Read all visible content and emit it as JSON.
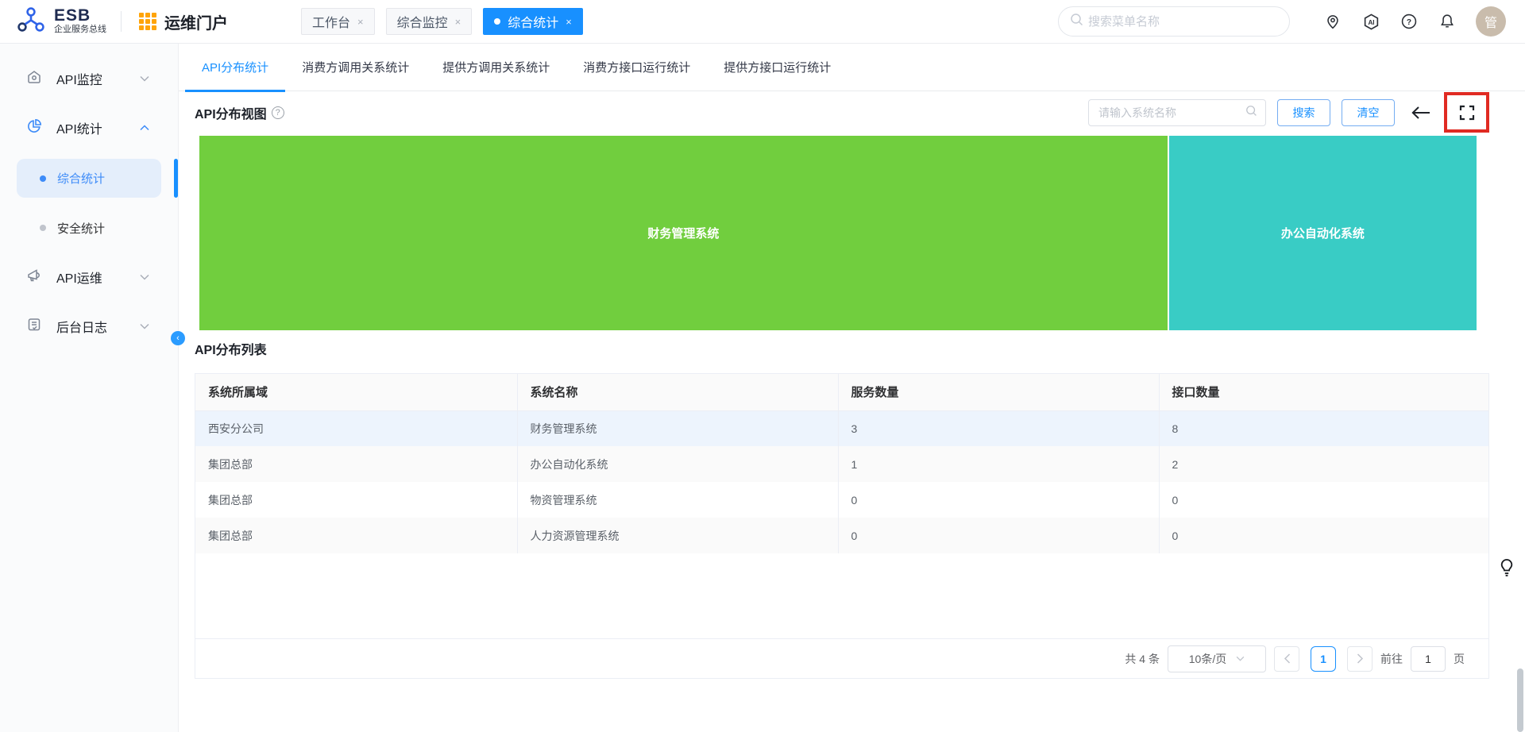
{
  "header": {
    "logo_title": "ESB",
    "logo_subtitle": "企业服务总线",
    "portal_title": "运维门户",
    "window_tabs": [
      {
        "label": "工作台",
        "active": false
      },
      {
        "label": "综合监控",
        "active": false
      },
      {
        "label": "综合统计",
        "active": true
      }
    ],
    "search_placeholder": "搜索菜单名称",
    "avatar_text": "管"
  },
  "sidebar": {
    "items": [
      {
        "label": "API监控"
      },
      {
        "label": "API统计"
      },
      {
        "label": "API运维"
      },
      {
        "label": "后台日志"
      }
    ],
    "children": [
      {
        "label": "综合统计",
        "active": true
      },
      {
        "label": "安全统计",
        "active": false
      }
    ]
  },
  "content": {
    "tabs": [
      {
        "label": "API分布统计",
        "active": true
      },
      {
        "label": "消费方调用关系统计"
      },
      {
        "label": "提供方调用关系统计"
      },
      {
        "label": "消费方接口运行统计"
      },
      {
        "label": "提供方接口运行统计"
      }
    ],
    "view_title": "API分布视图",
    "toolbar": {
      "input_placeholder": "请输入系统名称",
      "search_label": "搜索",
      "clear_label": "清空"
    },
    "list": {
      "title": "API分布列表",
      "columns": [
        "系统所属域",
        "系统名称",
        "服务数量",
        "接口数量"
      ],
      "rows": [
        [
          "西安分公司",
          "财务管理系统",
          "3",
          "8"
        ],
        [
          "集团总部",
          "办公自动化系统",
          "1",
          "2"
        ],
        [
          "集团总部",
          "物资管理系统",
          "0",
          "0"
        ],
        [
          "集团总部",
          "人力资源管理系统",
          "0",
          "0"
        ]
      ]
    },
    "pagination": {
      "total": "共 4 条",
      "page_size": "10条/页",
      "current": "1",
      "goto_label": "前往",
      "goto_value": "1",
      "page_label": "页"
    }
  },
  "chart_data": {
    "type": "treemap",
    "title": "API分布视图",
    "value_field": "接口数量",
    "items": [
      {
        "name": "财务管理系统",
        "value": 8,
        "color": "#71ce3e"
      },
      {
        "name": "办公自动化系统",
        "value": 2,
        "color": "#39ccc5"
      }
    ]
  },
  "colors": {
    "accent": "#1890ff",
    "treemap_green": "#71ce3e",
    "treemap_teal": "#39ccc5",
    "annotation_red": "#e02a22",
    "selected_row": "#edf4fd"
  }
}
